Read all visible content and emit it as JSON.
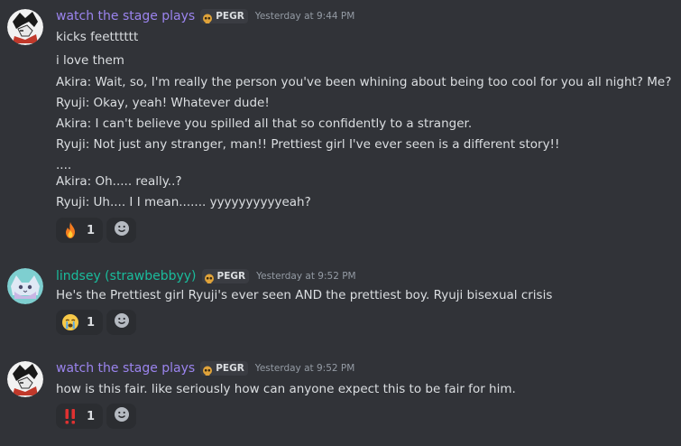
{
  "colors": {
    "background": "#313338",
    "username_purple": "#9b84ee",
    "username_cyan": "#1abc9c",
    "text": "#dbdee1",
    "muted": "#949ba4"
  },
  "messages": [
    {
      "avatar_icon": "anime-avatar-icon",
      "username": "watch the stage plays",
      "tag_icon": "skull-icon",
      "tag": "PEGR",
      "timestamp": "Yesterday at 9:44 PM",
      "lines": [
        "kicks feetttttt",
        "i love them",
        "Akira: Wait, so, I'm really the person you've been whining about being too cool for you all night? Me?",
        "Ryuji: Okay, yeah! Whatever dude!",
        "Akira: I can't believe you spilled all that so confidently to a stranger.",
        "Ryuji: Not just any stranger, man!! Prettiest girl I've ever seen is a different story!!",
        "....",
        "Akira: Oh..... really..?",
        "Ryuji: Uh.... I I mean....... yyyyyyyyyyeah?"
      ],
      "reaction": {
        "emoji_icon": "fire-icon",
        "count": "1"
      }
    },
    {
      "avatar_icon": "cat-avatar-icon",
      "username": "lindsey (strawbebbyy)",
      "tag_icon": "skull-icon",
      "tag": "PEGR",
      "timestamp": "Yesterday at 9:52 PM",
      "lines": [
        "He's the Prettiest girl Ryuji's ever seen AND the prettiest boy. Ryuji bisexual crisis"
      ],
      "reaction": {
        "emoji_icon": "crying-face-icon",
        "count": "1"
      }
    },
    {
      "avatar_icon": "anime-avatar-icon",
      "username": "watch the stage plays",
      "tag_icon": "skull-icon",
      "tag": "PEGR",
      "timestamp": "Yesterday at 9:52 PM",
      "lines": [
        "how is this fair. like seriously how can anyone expect this to be fair for him."
      ],
      "reaction": {
        "emoji_icon": "double-exclamation-icon",
        "count": "1"
      }
    }
  ]
}
